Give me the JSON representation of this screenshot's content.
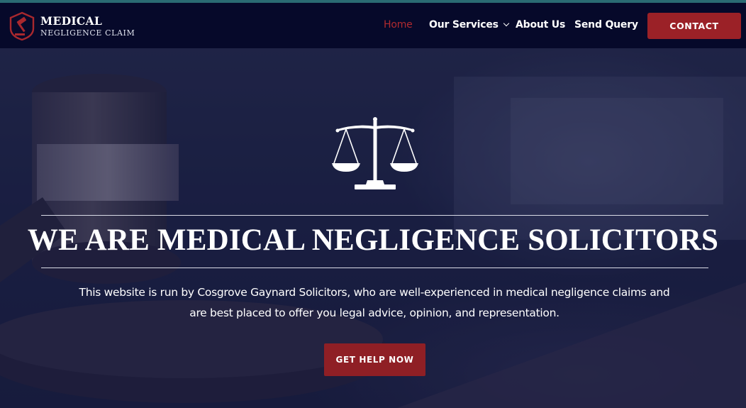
{
  "brand": {
    "title": "MEDICAL",
    "subtitle": "NEGLIGENCE CLAIM"
  },
  "nav": {
    "home": "Home",
    "services": "Our Services",
    "about": "About Us",
    "query": "Send Query",
    "contact": "CONTACT"
  },
  "hero": {
    "title": "WE ARE MEDICAL NEGLIGENCE SOLICITORS",
    "description": "This website is run by Cosgrove Gaynard Solicitors, who are well-experienced in medical negligence claims and are best placed to offer you legal advice, opinion, and representation.",
    "cta": "GET HELP NOW",
    "icon": "scales-of-justice-icon",
    "background": "judge-gavel-image"
  },
  "colors": {
    "header_bg": "#06092a",
    "accent_red": "#9b2127",
    "active_nav": "#b02a2f",
    "hero_overlay": "#1b2050"
  }
}
